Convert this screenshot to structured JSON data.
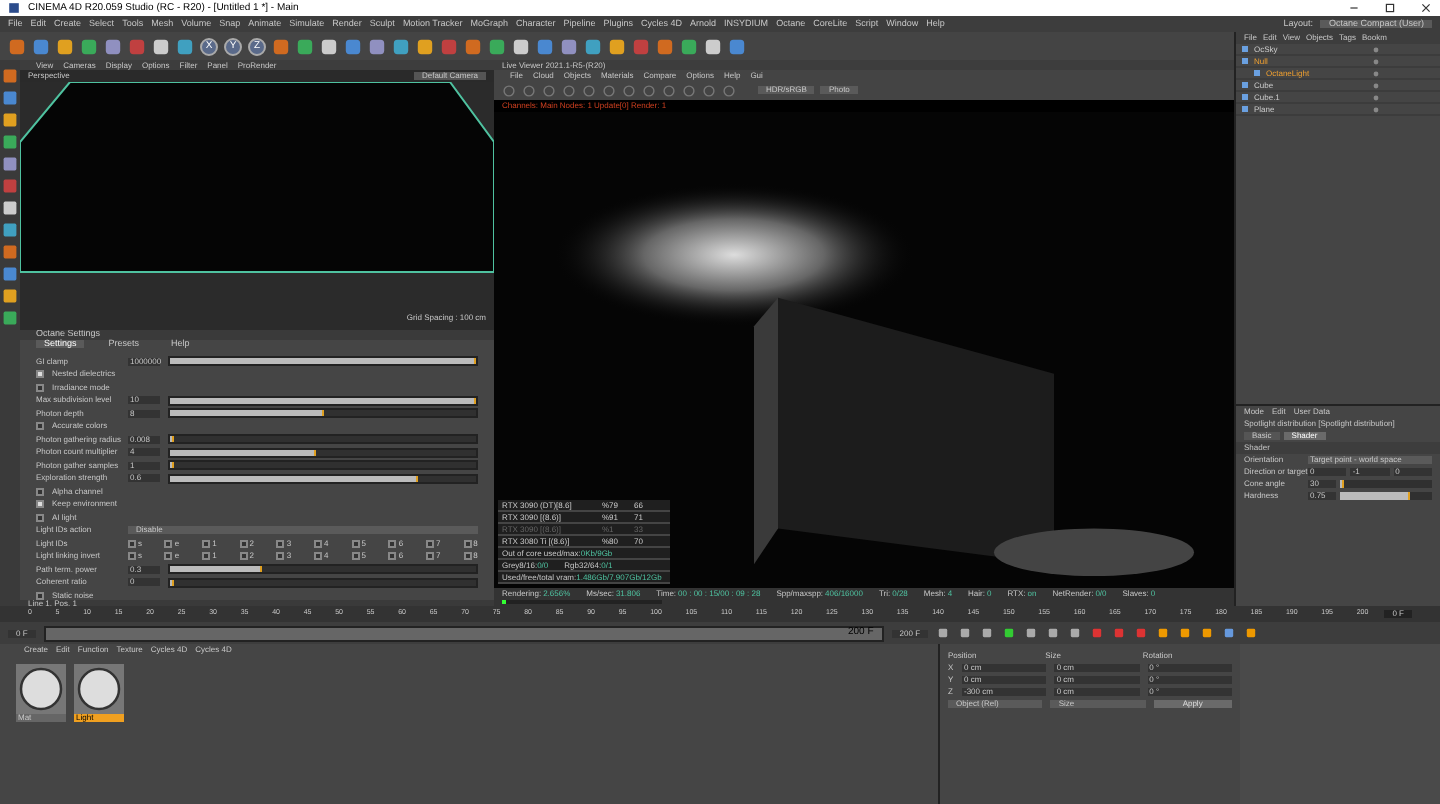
{
  "window": {
    "title": "CINEMA 4D R20.059 Studio (RC - R20) - [Untitled 1 *] - Main"
  },
  "menu": [
    "File",
    "Edit",
    "Create",
    "Select",
    "Tools",
    "Mesh",
    "Volume",
    "Snap",
    "Animate",
    "Simulate",
    "Render",
    "Sculpt",
    "Motion Tracker",
    "MoGraph",
    "Character",
    "Pipeline",
    "Plugins",
    "Cycles 4D",
    "Arnold",
    "INSYDIUM",
    "Octane",
    "CoreLite",
    "Script",
    "Window",
    "Help"
  ],
  "layout": {
    "label": "Layout:",
    "value": "Octane Compact (User)"
  },
  "toolbar": {
    "axes": [
      "X",
      "Y",
      "Z"
    ]
  },
  "viewport": {
    "menu": [
      "View",
      "Cameras",
      "Display",
      "Options",
      "Filter",
      "Panel",
      "ProRender"
    ],
    "camera_label": "Perspective",
    "camera": "Default Camera",
    "grid_spacing": "Grid Spacing : 100 cm"
  },
  "octane_settings": {
    "title": "Octane Settings",
    "tabs": [
      {
        "label": "Settings",
        "selected": true
      },
      {
        "label": "Presets",
        "selected": false
      },
      {
        "label": "Help",
        "selected": false
      }
    ],
    "rows": [
      {
        "kind": "slider",
        "label": "GI clamp",
        "value": "1000000",
        "level": 1.0
      },
      {
        "kind": "check",
        "label": "Nested dielectrics",
        "checked": true
      },
      {
        "kind": "check",
        "label": "Irradiance mode",
        "checked": false
      },
      {
        "kind": "slider",
        "label": "Max subdivision level",
        "value": "10",
        "level": 1.0
      },
      {
        "kind": "slider",
        "label": "Photon depth",
        "value": "8",
        "level": 0.5
      },
      {
        "kind": "check",
        "label": "Accurate colors",
        "checked": false
      },
      {
        "kind": "slider",
        "label": "Photon gathering radius",
        "value": "0.008",
        "level": 0.01
      },
      {
        "kind": "slider",
        "label": "Photon count multiplier",
        "value": "4",
        "level": 0.48
      },
      {
        "kind": "slider",
        "label": "Photon gather samples",
        "value": "1",
        "level": 0.01
      },
      {
        "kind": "slider",
        "label": "Exploration strength",
        "value": "0.6",
        "level": 0.81
      },
      {
        "kind": "check",
        "label": "Alpha channel",
        "checked": false
      },
      {
        "kind": "check",
        "label": "Keep environment",
        "checked": true
      },
      {
        "kind": "check",
        "label": "AI light",
        "checked": false
      },
      {
        "kind": "dropdown",
        "label": "Light IDs action",
        "value": "Disable"
      },
      {
        "kind": "ids",
        "label": "Light IDs",
        "ids": [
          {
            "label": "s",
            "checked": false
          },
          {
            "label": "e",
            "checked": false
          },
          {
            "label": "1",
            "checked": false
          },
          {
            "label": "2",
            "checked": false
          },
          {
            "label": "3",
            "checked": false
          },
          {
            "label": "4",
            "checked": false
          },
          {
            "label": "5",
            "checked": false
          },
          {
            "label": "6",
            "checked": false
          },
          {
            "label": "7",
            "checked": false
          },
          {
            "label": "8",
            "checked": false
          }
        ]
      },
      {
        "kind": "ids",
        "label": "Light linking invert",
        "ids": [
          {
            "label": "s",
            "checked": false
          },
          {
            "label": "e",
            "checked": false
          },
          {
            "label": "1",
            "checked": false
          },
          {
            "label": "2",
            "checked": false
          },
          {
            "label": "3",
            "checked": false
          },
          {
            "label": "4",
            "checked": false
          },
          {
            "label": "5",
            "checked": false
          },
          {
            "label": "6",
            "checked": false
          },
          {
            "label": "7",
            "checked": false
          },
          {
            "label": "8",
            "checked": false
          }
        ]
      },
      {
        "kind": "slider",
        "label": "Path term. power",
        "value": "0.3",
        "level": 0.3
      },
      {
        "kind": "slider",
        "label": "Coherent ratio",
        "value": "0",
        "level": 0.0
      },
      {
        "kind": "check",
        "label": "Static noise",
        "checked": false
      }
    ],
    "status": "Line 1, Pos. 1"
  },
  "live_viewer": {
    "title": "Live Viewer 2021.1-R5-(R20)",
    "menu": [
      "File",
      "Cloud",
      "Objects",
      "Materials",
      "Compare",
      "Options",
      "Help",
      "Gui"
    ],
    "color_mode": "HDR/sRGB",
    "camera_mode": "Photo",
    "status_line": "Channels: Main  Nodes: 1  Update[0]  Render: 1",
    "gpus": [
      {
        "name": "RTX 3090 (DT)[8.6]",
        "usage": "%79",
        "temp": "66",
        "disabled": false
      },
      {
        "name": "RTX 3090 [(8.6)]",
        "usage": "%91",
        "temp": "71",
        "disabled": false
      },
      {
        "name": "RTX 3090 [(8.6)]",
        "usage": "%1",
        "temp": "33",
        "disabled": true
      },
      {
        "name": "RTX 3080 Ti [(8.6)]",
        "usage": "%80",
        "temp": "70",
        "disabled": false
      }
    ],
    "memory": [
      [
        {
          "label": "Out of core used/max:",
          "value": "0Kb/9Gb"
        }
      ],
      [
        {
          "label": "Grey8/16:",
          "value": "0/0"
        },
        {
          "label": "Rgb32/64:",
          "value": "0/1"
        }
      ],
      [
        {
          "label": "Used/free/total vram:",
          "value": "1.486Gb/7.907Gb/12Gb"
        }
      ]
    ],
    "stats": [
      {
        "label": "Rendering:",
        "value": "2.656%"
      },
      {
        "label": "Ms/sec:",
        "value": "31.806"
      },
      {
        "label": "Time:",
        "value": "00 : 00 : 15/00 : 09 : 28"
      },
      {
        "label": "Spp/maxspp:",
        "value": "406/16000"
      },
      {
        "label": "Tri:",
        "value": "0/28"
      },
      {
        "label": "Mesh:",
        "value": "4"
      },
      {
        "label": "Hair:",
        "value": "0"
      },
      {
        "label": "RTX:",
        "value": "on"
      },
      {
        "label": "NetRender:",
        "value": "0/0"
      },
      {
        "label": "Slaves:",
        "value": "0"
      }
    ],
    "progress": {
      "level": 0.027
    }
  },
  "object_manager": {
    "menu": [
      "File",
      "Edit",
      "View",
      "Objects",
      "Tags",
      "Bookm"
    ],
    "objects": [
      {
        "name": "OcSky",
        "selected": false
      },
      {
        "name": "Null",
        "selected": true,
        "children": [
          {
            "name": "OctaneLight",
            "selected": true
          }
        ]
      },
      {
        "name": "Cube",
        "selected": false
      },
      {
        "name": "Cube.1",
        "selected": false
      },
      {
        "name": "Plane",
        "selected": false
      }
    ]
  },
  "attributes": {
    "menu": [
      "Mode",
      "Edit",
      "User Data"
    ],
    "object": "Spotlight distribution [Spotlight distribution]",
    "tabs": [
      {
        "label": "Basic",
        "selected": false
      },
      {
        "label": "Shader",
        "selected": true
      }
    ],
    "section": "Shader",
    "fields": [
      {
        "kind": "dropdown",
        "label": "Orientation",
        "value": "Target point - world space"
      },
      {
        "kind": "vector",
        "label": "Direction or target",
        "values": [
          "0",
          "-1",
          "0"
        ]
      },
      {
        "kind": "slider",
        "label": "Cone angle",
        "value": "30",
        "level": 0.05
      },
      {
        "kind": "slider",
        "label": "Hardness",
        "value": "0.75",
        "level": 0.75
      }
    ]
  },
  "timeline": {
    "ticks": [
      "0",
      "5",
      "10",
      "15",
      "20",
      "25",
      "30",
      "35",
      "40",
      "45",
      "50",
      "55",
      "60",
      "65",
      "70",
      "75",
      "80",
      "85",
      "90",
      "95",
      "100",
      "105",
      "110",
      "115",
      "120",
      "125",
      "130",
      "135",
      "140",
      "145",
      "150",
      "155",
      "160",
      "165",
      "170",
      "175",
      "180",
      "185",
      "190",
      "195",
      "200"
    ],
    "current": "0 F",
    "start": "0 F",
    "end": "200 F",
    "end_field": "200 F",
    "range": {
      "level": 1.0
    }
  },
  "materials": {
    "menu": [
      "Create",
      "Edit",
      "Function",
      "Texture",
      "Cycles 4D",
      "Cycles 4D"
    ],
    "items": [
      {
        "name": "Mat",
        "selected": false
      },
      {
        "name": "Light",
        "selected": true
      }
    ]
  },
  "coordinates": {
    "headers": [
      "Position",
      "Size",
      "Rotation"
    ],
    "rows": [
      {
        "axis": "X",
        "values": [
          "0 cm",
          "0 cm",
          "0 °"
        ]
      },
      {
        "axis": "Y",
        "values": [
          "0 cm",
          "0 cm",
          "0 °"
        ]
      },
      {
        "axis": "Z",
        "values": [
          "-300 cm",
          "0 cm",
          "0 °"
        ]
      }
    ],
    "mode": "Object (Rel)",
    "size_mode": "Size",
    "apply": "Apply"
  }
}
